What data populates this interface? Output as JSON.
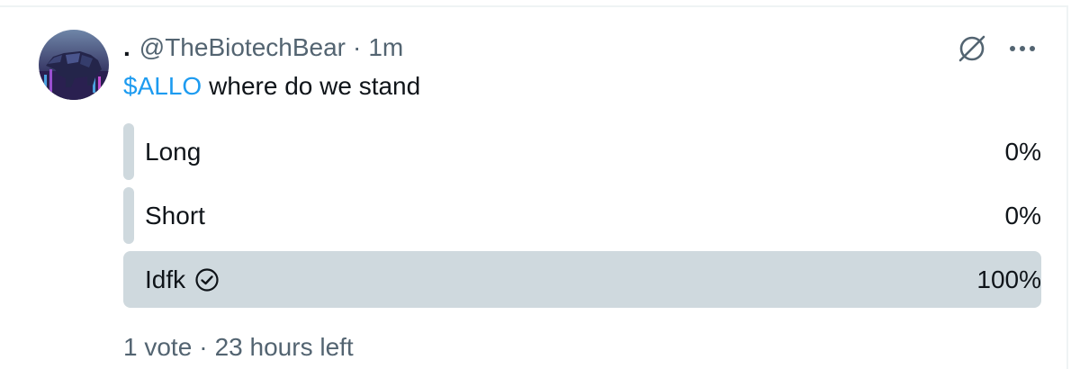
{
  "tweet": {
    "display_name": ".",
    "handle": "@TheBiotechBear",
    "separator": "·",
    "time": "1m",
    "cashtag": "$ALLO",
    "text": "where do we stand",
    "avatar_icon": "bear-avatar"
  },
  "header_icons": [
    "grok-icon",
    "more-icon"
  ],
  "poll": {
    "options": [
      {
        "label": "Long",
        "percent_text": "0%",
        "percent": 0,
        "selected": false
      },
      {
        "label": "Short",
        "percent_text": "0%",
        "percent": 0,
        "selected": false
      },
      {
        "label": "Idfk",
        "percent_text": "100%",
        "percent": 100,
        "selected": true
      }
    ],
    "votes": "1 vote",
    "separator": "·",
    "time_left": "23 hours left"
  },
  "colors": {
    "link": "#1d9bf0",
    "poll_fill": "#cfd9de",
    "secondary_text": "#536471",
    "primary_text": "#0f1419"
  }
}
